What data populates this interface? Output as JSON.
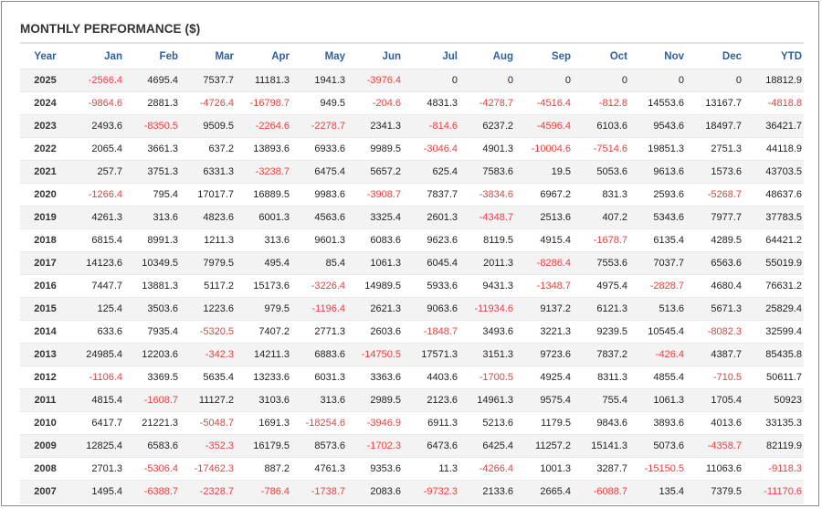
{
  "title": "MONTHLY PERFORMANCE ($)",
  "colors": {
    "negative": "#e8403e",
    "header": "#2f5f9f",
    "stripe": "#f3f3f3"
  },
  "chart_data": {
    "type": "table",
    "title": "MONTHLY PERFORMANCE ($)",
    "columns": [
      "Year",
      "Jan",
      "Feb",
      "Mar",
      "Apr",
      "May",
      "Jun",
      "Jul",
      "Aug",
      "Sep",
      "Oct",
      "Nov",
      "Dec",
      "YTD"
    ],
    "rows": [
      [
        "2025",
        "-2566.4",
        "4695.4",
        "7537.7",
        "11181.3",
        "1941.3",
        "-3976.4",
        "0",
        "0",
        "0",
        "0",
        "0",
        "0",
        "18812.9"
      ],
      [
        "2024",
        "-9864.6",
        "2881.3",
        "-4726.4",
        "-16798.7",
        "949.5",
        "-204.6",
        "4831.3",
        "-4278.7",
        "-4516.4",
        "-812.8",
        "14553.6",
        "13167.7",
        "-4818.8"
      ],
      [
        "2023",
        "2493.6",
        "-8350.5",
        "9509.5",
        "-2264.6",
        "-2278.7",
        "2341.3",
        "-814.6",
        "6237.2",
        "-4596.4",
        "6103.6",
        "9543.6",
        "18497.7",
        "36421.7"
      ],
      [
        "2022",
        "2065.4",
        "3661.3",
        "637.2",
        "13893.6",
        "6933.6",
        "9989.5",
        "-3046.4",
        "4901.3",
        "-10004.6",
        "-7514.6",
        "19851.3",
        "2751.3",
        "44118.9"
      ],
      [
        "2021",
        "257.7",
        "3751.3",
        "6331.3",
        "-3238.7",
        "6475.4",
        "5657.2",
        "625.4",
        "7583.6",
        "19.5",
        "5053.6",
        "9613.6",
        "1573.6",
        "43703.5"
      ],
      [
        "2020",
        "-1266.4",
        "795.4",
        "17017.7",
        "16889.5",
        "9983.6",
        "-3908.7",
        "7837.7",
        "-3834.6",
        "6967.2",
        "831.3",
        "2593.6",
        "-5268.7",
        "48637.6"
      ],
      [
        "2019",
        "4261.3",
        "313.6",
        "4823.6",
        "6001.3",
        "4563.6",
        "3325.4",
        "2601.3",
        "-4348.7",
        "2513.6",
        "407.2",
        "5343.6",
        "7977.7",
        "37783.5"
      ],
      [
        "2018",
        "6815.4",
        "8991.3",
        "1211.3",
        "313.6",
        "9601.3",
        "6083.6",
        "9623.6",
        "8119.5",
        "4915.4",
        "-1678.7",
        "6135.4",
        "4289.5",
        "64421.2"
      ],
      [
        "2017",
        "14123.6",
        "10349.5",
        "7979.5",
        "495.4",
        "85.4",
        "1061.3",
        "6045.4",
        "2011.3",
        "-8286.4",
        "7553.6",
        "7037.7",
        "6563.6",
        "55019.9"
      ],
      [
        "2016",
        "7447.7",
        "13881.3",
        "5117.2",
        "15173.6",
        "-3226.4",
        "14989.5",
        "5933.6",
        "9431.3",
        "-1348.7",
        "4975.4",
        "-2828.7",
        "4680.4",
        "76631.2"
      ],
      [
        "2015",
        "125.4",
        "3503.6",
        "1223.6",
        "979.5",
        "-1196.4",
        "2621.3",
        "9063.6",
        "-11934.6",
        "9137.2",
        "6121.3",
        "513.6",
        "5671.3",
        "25829.4"
      ],
      [
        "2014",
        "633.6",
        "7935.4",
        "-5320.5",
        "7407.2",
        "2771.3",
        "2603.6",
        "-1848.7",
        "3493.6",
        "3221.3",
        "9239.5",
        "10545.4",
        "-8082.3",
        "32599.4"
      ],
      [
        "2013",
        "24985.4",
        "12203.6",
        "-342.3",
        "14211.3",
        "6883.6",
        "-14750.5",
        "17571.3",
        "3151.3",
        "9723.6",
        "7837.2",
        "-426.4",
        "4387.7",
        "85435.8"
      ],
      [
        "2012",
        "-1106.4",
        "3369.5",
        "5635.4",
        "13233.6",
        "6031.3",
        "3363.6",
        "4403.6",
        "-1700.5",
        "4925.4",
        "8311.3",
        "4855.4",
        "-710.5",
        "50611.7"
      ],
      [
        "2011",
        "4815.4",
        "-1608.7",
        "11127.2",
        "3103.6",
        "313.6",
        "2989.5",
        "2123.6",
        "14961.3",
        "9575.4",
        "755.4",
        "1061.3",
        "1705.4",
        "50923"
      ],
      [
        "2010",
        "6417.7",
        "21221.3",
        "-5048.7",
        "1691.3",
        "-18254.6",
        "-3946.9",
        "6911.3",
        "5213.6",
        "1179.5",
        "9843.6",
        "3893.6",
        "4013.6",
        "33135.3"
      ],
      [
        "2009",
        "12825.4",
        "6583.6",
        "-352.3",
        "16179.5",
        "8573.6",
        "-1702.3",
        "6473.6",
        "6425.4",
        "11257.2",
        "15141.3",
        "5073.6",
        "-4358.7",
        "82119.9"
      ],
      [
        "2008",
        "2701.3",
        "-5306.4",
        "-17462.3",
        "887.2",
        "4761.3",
        "9353.6",
        "11.3",
        "-4266.4",
        "1001.3",
        "3287.7",
        "-15150.5",
        "11063.6",
        "-9118.3"
      ],
      [
        "2007",
        "1495.4",
        "-6388.7",
        "-2328.7",
        "-786.4",
        "-1738.7",
        "2083.6",
        "-9732.3",
        "2133.6",
        "2665.4",
        "-6088.7",
        "135.4",
        "7379.5",
        "-11170.6"
      ]
    ]
  }
}
